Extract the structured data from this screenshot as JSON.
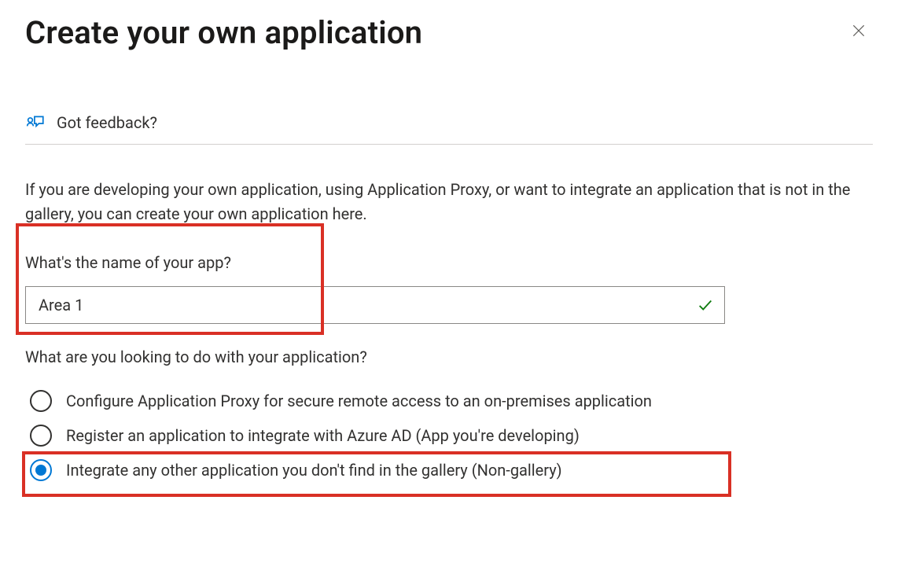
{
  "header": {
    "title": "Create your own application"
  },
  "feedback": {
    "label": "Got feedback?"
  },
  "description": "If you are developing your own application, using Application Proxy, or want to integrate an application that is not in the gallery, you can create your own application here.",
  "nameField": {
    "label": "What's the name of your app?",
    "value": "Area 1",
    "valid": true
  },
  "radioQuestion": "What are you looking to do with your application?",
  "options": [
    {
      "label": "Configure Application Proxy for secure remote access to an on-premises application",
      "selected": false
    },
    {
      "label": "Register an application to integrate with Azure AD (App you're developing)",
      "selected": false
    },
    {
      "label": "Integrate any other application you don't find in the gallery (Non-gallery)",
      "selected": true
    }
  ],
  "colors": {
    "accent": "#0078d4",
    "highlight": "#d93025",
    "success": "#107c10"
  }
}
